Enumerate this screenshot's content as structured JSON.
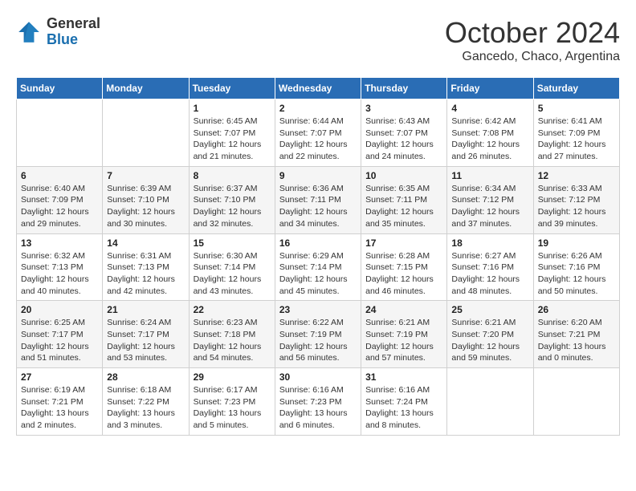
{
  "logo": {
    "general": "General",
    "blue": "Blue"
  },
  "title": {
    "month": "October 2024",
    "location": "Gancedo, Chaco, Argentina"
  },
  "weekdays": [
    "Sunday",
    "Monday",
    "Tuesday",
    "Wednesday",
    "Thursday",
    "Friday",
    "Saturday"
  ],
  "weeks": [
    [
      null,
      null,
      {
        "day": "1",
        "sunrise": "Sunrise: 6:45 AM",
        "sunset": "Sunset: 7:07 PM",
        "daylight": "Daylight: 12 hours and 21 minutes."
      },
      {
        "day": "2",
        "sunrise": "Sunrise: 6:44 AM",
        "sunset": "Sunset: 7:07 PM",
        "daylight": "Daylight: 12 hours and 22 minutes."
      },
      {
        "day": "3",
        "sunrise": "Sunrise: 6:43 AM",
        "sunset": "Sunset: 7:07 PM",
        "daylight": "Daylight: 12 hours and 24 minutes."
      },
      {
        "day": "4",
        "sunrise": "Sunrise: 6:42 AM",
        "sunset": "Sunset: 7:08 PM",
        "daylight": "Daylight: 12 hours and 26 minutes."
      },
      {
        "day": "5",
        "sunrise": "Sunrise: 6:41 AM",
        "sunset": "Sunset: 7:09 PM",
        "daylight": "Daylight: 12 hours and 27 minutes."
      }
    ],
    [
      {
        "day": "6",
        "sunrise": "Sunrise: 6:40 AM",
        "sunset": "Sunset: 7:09 PM",
        "daylight": "Daylight: 12 hours and 29 minutes."
      },
      {
        "day": "7",
        "sunrise": "Sunrise: 6:39 AM",
        "sunset": "Sunset: 7:10 PM",
        "daylight": "Daylight: 12 hours and 30 minutes."
      },
      {
        "day": "8",
        "sunrise": "Sunrise: 6:37 AM",
        "sunset": "Sunset: 7:10 PM",
        "daylight": "Daylight: 12 hours and 32 minutes."
      },
      {
        "day": "9",
        "sunrise": "Sunrise: 6:36 AM",
        "sunset": "Sunset: 7:11 PM",
        "daylight": "Daylight: 12 hours and 34 minutes."
      },
      {
        "day": "10",
        "sunrise": "Sunrise: 6:35 AM",
        "sunset": "Sunset: 7:11 PM",
        "daylight": "Daylight: 12 hours and 35 minutes."
      },
      {
        "day": "11",
        "sunrise": "Sunrise: 6:34 AM",
        "sunset": "Sunset: 7:12 PM",
        "daylight": "Daylight: 12 hours and 37 minutes."
      },
      {
        "day": "12",
        "sunrise": "Sunrise: 6:33 AM",
        "sunset": "Sunset: 7:12 PM",
        "daylight": "Daylight: 12 hours and 39 minutes."
      }
    ],
    [
      {
        "day": "13",
        "sunrise": "Sunrise: 6:32 AM",
        "sunset": "Sunset: 7:13 PM",
        "daylight": "Daylight: 12 hours and 40 minutes."
      },
      {
        "day": "14",
        "sunrise": "Sunrise: 6:31 AM",
        "sunset": "Sunset: 7:13 PM",
        "daylight": "Daylight: 12 hours and 42 minutes."
      },
      {
        "day": "15",
        "sunrise": "Sunrise: 6:30 AM",
        "sunset": "Sunset: 7:14 PM",
        "daylight": "Daylight: 12 hours and 43 minutes."
      },
      {
        "day": "16",
        "sunrise": "Sunrise: 6:29 AM",
        "sunset": "Sunset: 7:14 PM",
        "daylight": "Daylight: 12 hours and 45 minutes."
      },
      {
        "day": "17",
        "sunrise": "Sunrise: 6:28 AM",
        "sunset": "Sunset: 7:15 PM",
        "daylight": "Daylight: 12 hours and 46 minutes."
      },
      {
        "day": "18",
        "sunrise": "Sunrise: 6:27 AM",
        "sunset": "Sunset: 7:16 PM",
        "daylight": "Daylight: 12 hours and 48 minutes."
      },
      {
        "day": "19",
        "sunrise": "Sunrise: 6:26 AM",
        "sunset": "Sunset: 7:16 PM",
        "daylight": "Daylight: 12 hours and 50 minutes."
      }
    ],
    [
      {
        "day": "20",
        "sunrise": "Sunrise: 6:25 AM",
        "sunset": "Sunset: 7:17 PM",
        "daylight": "Daylight: 12 hours and 51 minutes."
      },
      {
        "day": "21",
        "sunrise": "Sunrise: 6:24 AM",
        "sunset": "Sunset: 7:17 PM",
        "daylight": "Daylight: 12 hours and 53 minutes."
      },
      {
        "day": "22",
        "sunrise": "Sunrise: 6:23 AM",
        "sunset": "Sunset: 7:18 PM",
        "daylight": "Daylight: 12 hours and 54 minutes."
      },
      {
        "day": "23",
        "sunrise": "Sunrise: 6:22 AM",
        "sunset": "Sunset: 7:19 PM",
        "daylight": "Daylight: 12 hours and 56 minutes."
      },
      {
        "day": "24",
        "sunrise": "Sunrise: 6:21 AM",
        "sunset": "Sunset: 7:19 PM",
        "daylight": "Daylight: 12 hours and 57 minutes."
      },
      {
        "day": "25",
        "sunrise": "Sunrise: 6:21 AM",
        "sunset": "Sunset: 7:20 PM",
        "daylight": "Daylight: 12 hours and 59 minutes."
      },
      {
        "day": "26",
        "sunrise": "Sunrise: 6:20 AM",
        "sunset": "Sunset: 7:21 PM",
        "daylight": "Daylight: 13 hours and 0 minutes."
      }
    ],
    [
      {
        "day": "27",
        "sunrise": "Sunrise: 6:19 AM",
        "sunset": "Sunset: 7:21 PM",
        "daylight": "Daylight: 13 hours and 2 minutes."
      },
      {
        "day": "28",
        "sunrise": "Sunrise: 6:18 AM",
        "sunset": "Sunset: 7:22 PM",
        "daylight": "Daylight: 13 hours and 3 minutes."
      },
      {
        "day": "29",
        "sunrise": "Sunrise: 6:17 AM",
        "sunset": "Sunset: 7:23 PM",
        "daylight": "Daylight: 13 hours and 5 minutes."
      },
      {
        "day": "30",
        "sunrise": "Sunrise: 6:16 AM",
        "sunset": "Sunset: 7:23 PM",
        "daylight": "Daylight: 13 hours and 6 minutes."
      },
      {
        "day": "31",
        "sunrise": "Sunrise: 6:16 AM",
        "sunset": "Sunset: 7:24 PM",
        "daylight": "Daylight: 13 hours and 8 minutes."
      },
      null,
      null
    ]
  ]
}
